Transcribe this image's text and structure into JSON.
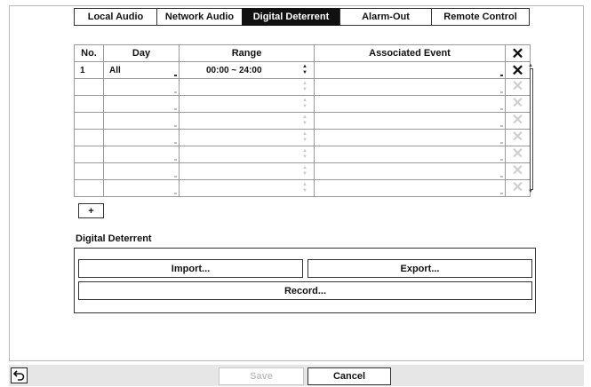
{
  "tabs": [
    {
      "label": "Local Audio"
    },
    {
      "label": "Network Audio"
    },
    {
      "label": "Digital Deterrent"
    },
    {
      "label": "Alarm-Out"
    },
    {
      "label": "Remote Control"
    }
  ],
  "active_tab": "Digital Deterrent",
  "table": {
    "headers": {
      "no": "No.",
      "day": "Day",
      "range": "Range",
      "event": "Associated Event",
      "delete_icon": "close-icon"
    },
    "rows": [
      {
        "no": "1",
        "day": "All",
        "range": "00:00 ~ 24:00",
        "event": ""
      },
      {
        "no": "",
        "day": "",
        "range": "",
        "event": ""
      },
      {
        "no": "",
        "day": "",
        "range": "",
        "event": ""
      },
      {
        "no": "",
        "day": "",
        "range": "",
        "event": ""
      },
      {
        "no": "",
        "day": "",
        "range": "",
        "event": ""
      },
      {
        "no": "",
        "day": "",
        "range": "",
        "event": ""
      },
      {
        "no": "",
        "day": "",
        "range": "",
        "event": ""
      },
      {
        "no": "",
        "day": "",
        "range": "",
        "event": ""
      }
    ]
  },
  "add_button": {
    "label": "+"
  },
  "section": {
    "title": "Digital Deterrent",
    "import_label": "Import...",
    "export_label": "Export...",
    "record_label": "Record..."
  },
  "footer": {
    "back_icon": "back-arrow-icon",
    "save_label": "Save",
    "cancel_label": "Cancel"
  }
}
